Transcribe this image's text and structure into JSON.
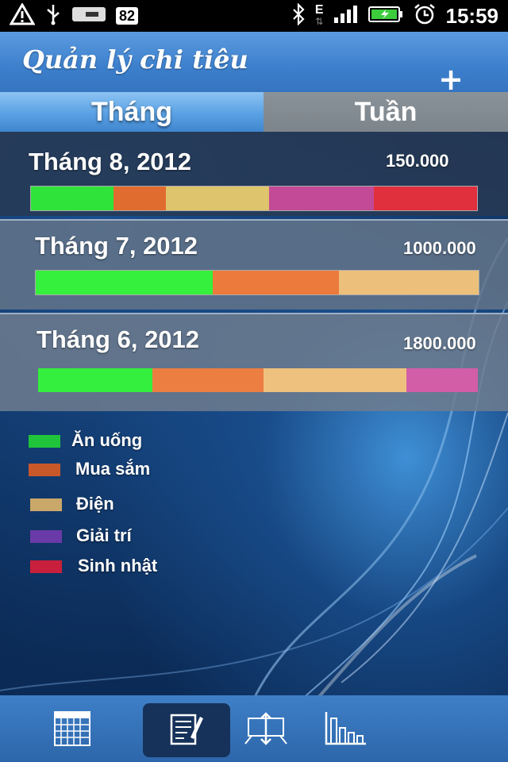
{
  "status_bar": {
    "battery_level": "82",
    "network_type": "E",
    "time": "15:59"
  },
  "header": {
    "title": "Quản lý chi tiêu",
    "add_label": "+"
  },
  "tabs": [
    {
      "label": "Tháng",
      "active": true
    },
    {
      "label": "Tuần",
      "active": false
    }
  ],
  "categories": [
    {
      "name": "Ăn uống",
      "color": "#20c43a"
    },
    {
      "name": "Mua sắm",
      "color": "#c8582a"
    },
    {
      "name": "Điện",
      "color": "#c9a86a"
    },
    {
      "name": "Giải trí",
      "color": "#6a3aa8"
    },
    {
      "name": "Sinh nhật",
      "color": "#c8203c"
    }
  ],
  "months": [
    {
      "label": "Tháng 8, 2012",
      "total": "150.000",
      "segments": [
        {
          "category": "Ăn uống",
          "fraction": 0.185,
          "color": "#2fe33a"
        },
        {
          "category": "Mua sắm",
          "fraction": 0.117,
          "color": "#e06c30"
        },
        {
          "category": "Điện",
          "fraction": 0.231,
          "color": "#dec46c"
        },
        {
          "category": "Giải trí",
          "fraction": 0.235,
          "color": "#c24a96"
        },
        {
          "category": "Sinh nhật",
          "fraction": 0.232,
          "color": "#e0303e"
        }
      ]
    },
    {
      "label": "Tháng 7, 2012",
      "total": "1000.000",
      "segments": [
        {
          "category": "Ăn uống",
          "fraction": 0.4,
          "color": "#35f03c"
        },
        {
          "category": "Mua sắm",
          "fraction": 0.285,
          "color": "#ec7a3c"
        },
        {
          "category": "Điện",
          "fraction": 0.315,
          "color": "#ecc07a"
        }
      ]
    },
    {
      "label": "Tháng 6, 2012",
      "total": "1800.000",
      "segments": [
        {
          "category": "Ăn uống",
          "fraction": 0.26,
          "color": "#35ef3e"
        },
        {
          "category": "Mua sắm",
          "fraction": 0.253,
          "color": "#ec7e42"
        },
        {
          "category": "Điện",
          "fraction": 0.325,
          "color": "#eec17e"
        },
        {
          "category": "Giải trí",
          "fraction": 0.162,
          "color": "#d25ea8"
        }
      ]
    }
  ],
  "bottom_nav": [
    {
      "icon": "calendar-icon",
      "active": false
    },
    {
      "icon": "notes-icon",
      "active": true
    },
    {
      "icon": "transfer-icon",
      "active": false
    },
    {
      "icon": "bar-chart-icon",
      "active": false
    }
  ]
}
